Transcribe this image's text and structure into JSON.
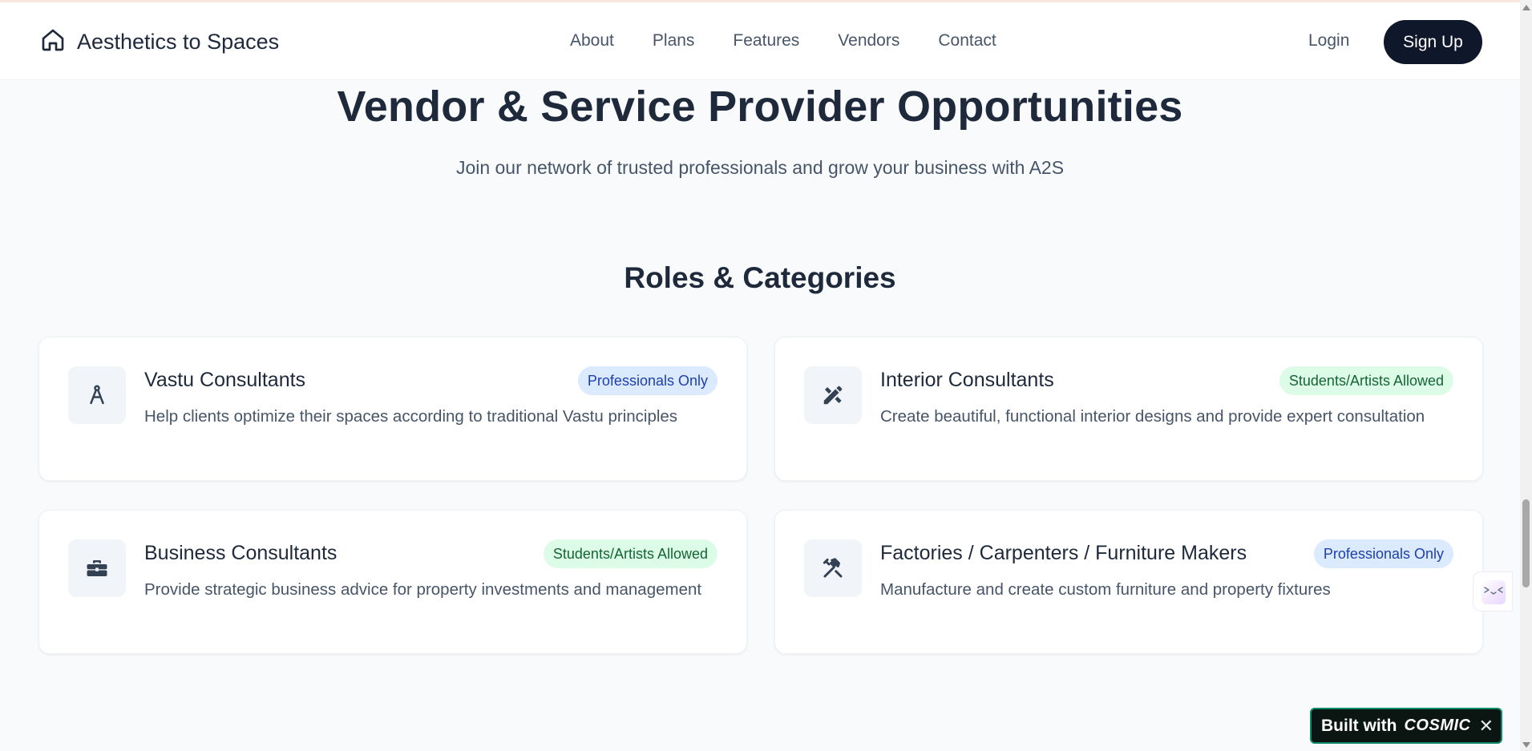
{
  "header": {
    "brand": "Aesthetics to Spaces",
    "nav": [
      "About",
      "Plans",
      "Features",
      "Vendors",
      "Contact"
    ],
    "login": "Login",
    "signup": "Sign Up"
  },
  "hero": {
    "title": "Vendor & Service Provider Opportunities",
    "subtitle": "Join our network of trusted professionals and grow your business with A2S"
  },
  "roles": {
    "title": "Roles & Categories",
    "cards": [
      {
        "title": "Vastu Consultants",
        "badge": "Professionals Only",
        "badge_type": "professionals",
        "description": "Help clients optimize their spaces according to traditional Vastu principles",
        "icon": "compass-icon"
      },
      {
        "title": "Interior Consultants",
        "badge": "Students/Artists Allowed",
        "badge_type": "students",
        "description": "Create beautiful, functional interior designs and provide expert consultation",
        "icon": "pencil-ruler-icon"
      },
      {
        "title": "Business Consultants",
        "badge": "Students/Artists Allowed",
        "badge_type": "students",
        "description": "Provide strategic business advice for property investments and management",
        "icon": "briefcase-icon"
      },
      {
        "title": "Factories / Carpenters / Furniture Makers",
        "badge": "Professionals Only",
        "badge_type": "professionals",
        "description": "Manufacture and create custom furniture and property fixtures",
        "icon": "hammer-wrench-icon"
      }
    ]
  },
  "cosmic_badge": {
    "label": "Built with",
    "logo": "COSMIC",
    "close": "✕"
  },
  "colors": {
    "primary_dark": "#0f172a",
    "background": "#f8fafc",
    "badge_professionals_bg": "#dbeafe",
    "badge_professionals_text": "#1e40af",
    "badge_students_bg": "#dcfce7",
    "badge_students_text": "#166534"
  }
}
